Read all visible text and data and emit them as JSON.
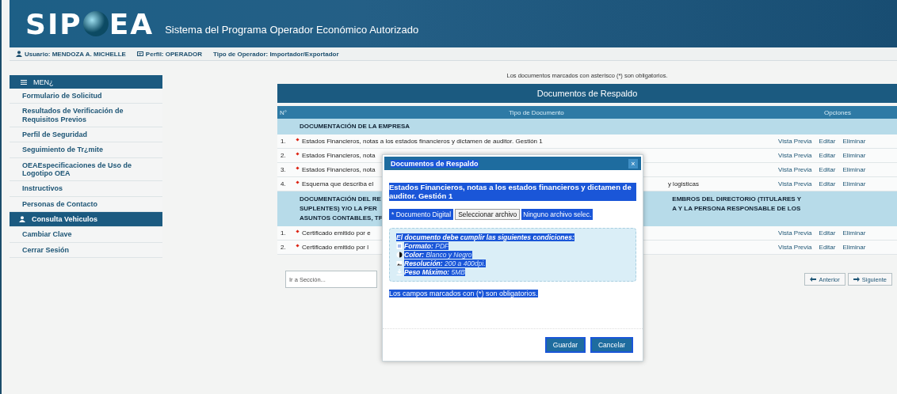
{
  "header": {
    "logo_left": "SIP",
    "logo_right": "EA",
    "subtitle": "Sistema del Programa Operador Económico Autorizado"
  },
  "user_bar": [
    {
      "kind": "user",
      "text": "Usuario: MENDOZA A. MICHELLE"
    },
    {
      "kind": "profile",
      "text": "Perfil: OPERADOR"
    },
    {
      "kind": "plain",
      "text": "Tipo de Operador: Importador/Exportador"
    }
  ],
  "sidebar": {
    "title": "MEN¿",
    "items": [
      {
        "label": "Formulario de Solicitud",
        "selected": false
      },
      {
        "label": "Resultados de Verificación de Requisitos Previos",
        "selected": false
      },
      {
        "label": "Perfil de Seguridad",
        "selected": false
      },
      {
        "label": "Seguimiento de Tr¿mite",
        "selected": false
      },
      {
        "label": "OEAEspecificaciones de Uso de Logotipo OEA",
        "selected": false
      },
      {
        "label": "Instructivos",
        "selected": false
      },
      {
        "label": "Personas de Contacto",
        "selected": false
      },
      {
        "label": "Consulta Vehiculos",
        "selected": true
      },
      {
        "label": "Cambiar Clave",
        "selected": false
      },
      {
        "label": "Cerrar Sesión",
        "selected": false
      }
    ]
  },
  "notice": "Los documentos marcados con asterisco (*) son obligatorios.",
  "table": {
    "title": "Documentos de Respaldo",
    "columns": [
      "N°",
      "Tipo de Documento",
      "Opciones"
    ],
    "sections": [
      {
        "title_left": [
          "DOCUMENTACIÓN DE LA EMPRESA"
        ],
        "rows": [
          {
            "number": "1.",
            "required": true,
            "text_left": "Estados Financieros, notas a los estados financieros y dictamen de auditor. Gestión 1",
            "actions": [
              "Vista Previa",
              "Editar",
              "Eliminar"
            ]
          },
          {
            "number": "2.",
            "required": true,
            "text_left": "Estados Financieros, nota",
            "actions": [
              "Vista Previa",
              "Editar",
              "Eliminar"
            ]
          },
          {
            "number": "3.",
            "required": true,
            "text_left": "Estados Financieros, nota",
            "actions": [
              "Vista Previa",
              "Editar",
              "Eliminar"
            ]
          },
          {
            "number": "4.",
            "required": true,
            "text_left": "Esquema que describa el",
            "text_right": "y logisticas",
            "actions": [
              "Vista Previa",
              "Editar",
              "Eliminar"
            ]
          }
        ]
      },
      {
        "title_left": [
          "DOCUMENTACIÓN DEL RE",
          "SUPLENTES) Y/O LA PER",
          "ASUNTOS CONTABLES, TF"
        ],
        "title_right": [
          "EMBROS DEL DIRECTORIO (TITULARES Y",
          "A Y LA PERSONA RESPONSABLE DE LOS"
        ],
        "rows": [
          {
            "number": "1.",
            "required": true,
            "text_left": "Certificado emitido por e",
            "actions": [
              "Vista Previa",
              "Editar",
              "Eliminar"
            ]
          },
          {
            "number": "2.",
            "required": true,
            "text_left": "Certificado emitido por l",
            "actions": [
              "Vista Previa",
              "Editar",
              "Eliminar"
            ]
          }
        ]
      }
    ]
  },
  "section_select": {
    "placeholder": "Ir a Sección..."
  },
  "pager": [
    {
      "kind": "prev",
      "label": "Anterior"
    },
    {
      "kind": "next",
      "label": "Siguiente"
    }
  ],
  "modal": {
    "title": "Documentos de Respaldo",
    "close": "×",
    "document": "Estados Financieros, notas a los estados financieros y dictamen de auditor. Gestión 1",
    "file_label": "* Documento Digital",
    "file_button": "Seleccionar archivo",
    "file_status": "Ninguno archivo selec.",
    "conditions_title": "El documento debe cumplir las siguientes condiciones:",
    "conditions": [
      {
        "kind": "format",
        "label": "Formato:",
        "value": "PDF"
      },
      {
        "kind": "color",
        "label": "Color:",
        "value": "Blanco y Negro"
      },
      {
        "kind": "resolution",
        "label": "Resolución:",
        "value": "200 a 400dpi."
      },
      {
        "kind": "size",
        "label": "Peso Máximo:",
        "value": "5MB"
      }
    ],
    "footnote": "Los campos marcados con (*) son obligatorios.",
    "buttons": [
      "Guardar",
      "Cancelar"
    ]
  }
}
